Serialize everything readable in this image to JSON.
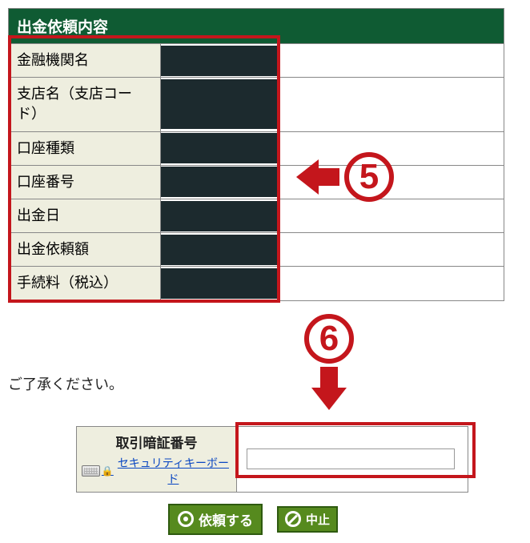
{
  "header": {
    "title": "出金依頼内容"
  },
  "rows": {
    "bank": {
      "label": "金融機関名"
    },
    "branch": {
      "label": "支店名（支店コード）"
    },
    "accountType": {
      "label": "口座種類"
    },
    "accountNo": {
      "label": "口座番号"
    },
    "withdrawDate": {
      "label": "出金日"
    },
    "amount": {
      "label": "出金依頼額"
    },
    "fee": {
      "label": "手続料（税込）"
    }
  },
  "footerNote": "ご了承ください。",
  "pin": {
    "label": "取引暗証番号",
    "securityLinkText": "セキュリティキーボード",
    "value": ""
  },
  "buttons": {
    "submit": "依頼する",
    "cancel": "中止"
  },
  "callouts": {
    "five": "5",
    "six": "6"
  }
}
